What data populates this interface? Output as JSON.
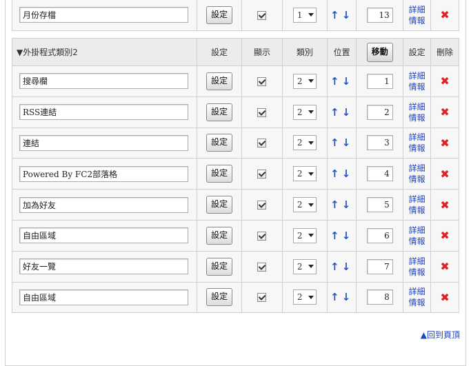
{
  "top_row": {
    "name": "月份存檔",
    "set_label": "設定",
    "class": "1",
    "position": "13",
    "detail": [
      "詳細",
      "情報"
    ]
  },
  "header": {
    "category": "▼外掛程式類別2",
    "set": "設定",
    "show": "顯示",
    "class": "類別",
    "position": "位置",
    "move": "移動",
    "detail_set": "設定",
    "delete": "刪除"
  },
  "rows": [
    {
      "name": "搜尋欄",
      "set_label": "設定",
      "class": "2",
      "position": "1",
      "detail": [
        "詳細",
        "情報"
      ]
    },
    {
      "name": "RSS連結",
      "set_label": "設定",
      "class": "2",
      "position": "2",
      "detail": [
        "詳細",
        "情報"
      ]
    },
    {
      "name": "連結",
      "set_label": "設定",
      "class": "2",
      "position": "3",
      "detail": [
        "詳細",
        "情報"
      ]
    },
    {
      "name": "Powered By FC2部落格",
      "set_label": "設定",
      "class": "2",
      "position": "4",
      "detail": [
        "詳細",
        "情報"
      ]
    },
    {
      "name": "加為好友",
      "set_label": "設定",
      "class": "2",
      "position": "5",
      "detail": [
        "詳細",
        "情報"
      ]
    },
    {
      "name": "自由區域",
      "set_label": "設定",
      "class": "2",
      "position": "6",
      "detail": [
        "詳細",
        "情報"
      ]
    },
    {
      "name": "好友一覽",
      "set_label": "設定",
      "class": "2",
      "position": "7",
      "detail": [
        "詳細",
        "情報"
      ]
    },
    {
      "name": "自由區域",
      "set_label": "設定",
      "class": "2",
      "position": "8",
      "detail": [
        "詳細",
        "情報"
      ]
    }
  ],
  "up_arrow": "↑",
  "down_arrow": "↓",
  "delete_icon": "✖",
  "back_to_top": "▲回到頁頂",
  "colors": {
    "link": "#2244bb",
    "arrow": "#2255cc",
    "delete": "#dd2222",
    "header_bg": "#ececec",
    "row_bg": "#f7f7f7"
  }
}
